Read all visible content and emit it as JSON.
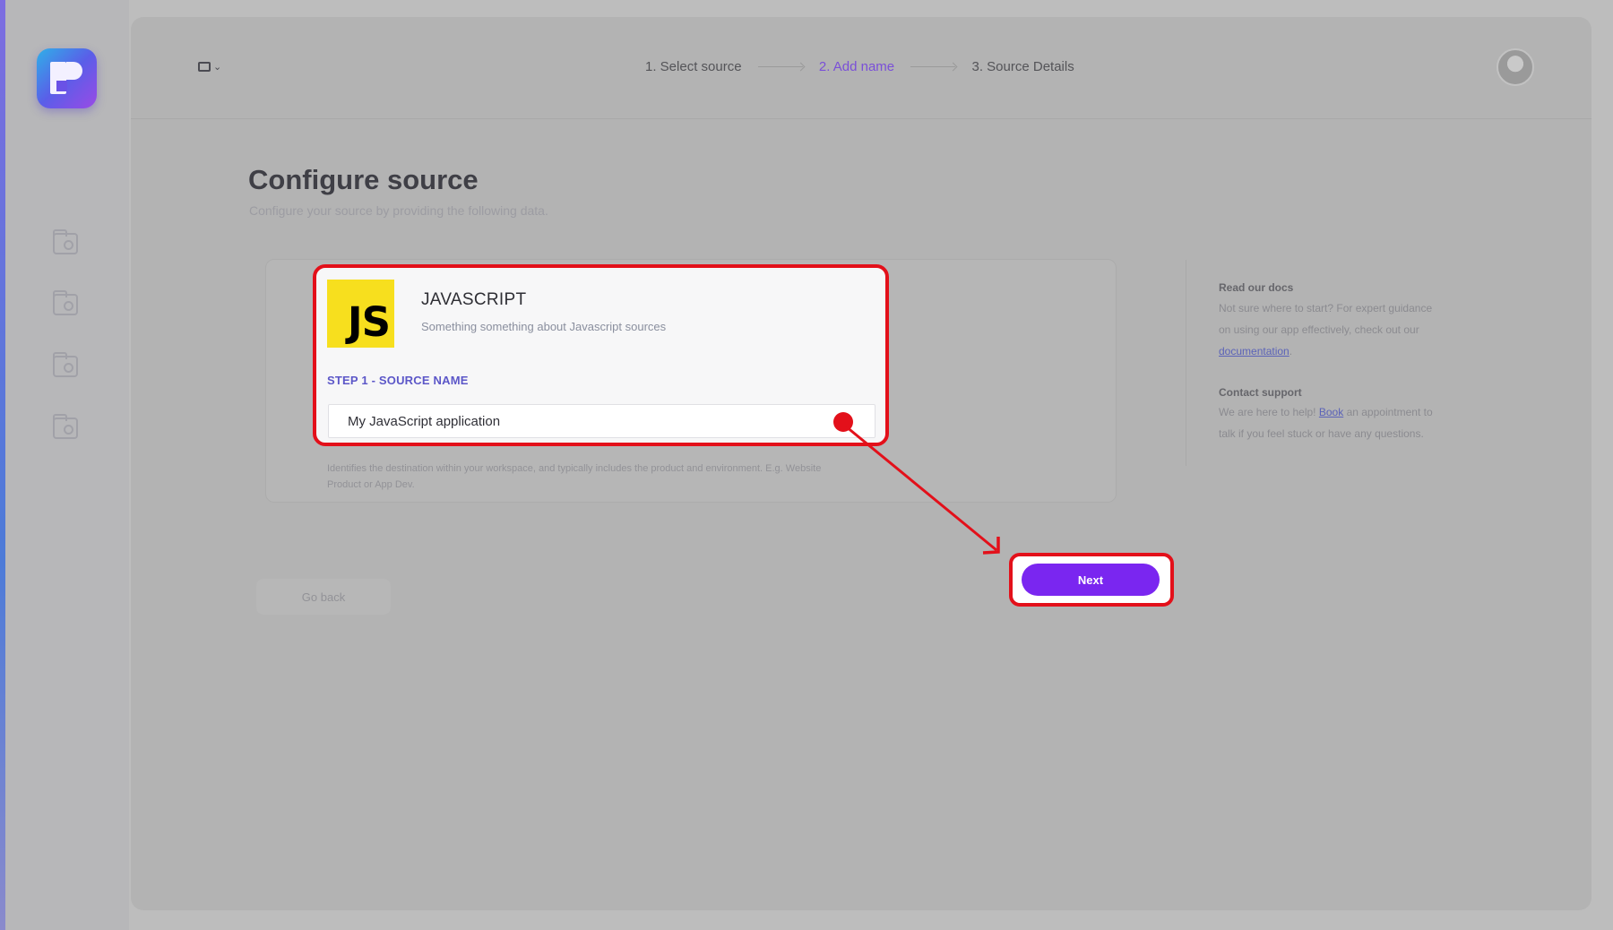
{
  "stepper": {
    "step1": "1. Select source",
    "step2": "2. Add name",
    "step3": "3. Source Details"
  },
  "page": {
    "title": "Configure source",
    "subtitle": "Configure your source by providing the following data."
  },
  "source_card": {
    "logo_text": "JS",
    "name": "JAVASCRIPT",
    "description": "Something something about Javascript sources",
    "step_label": "STEP 1 - SOURCE NAME",
    "input_value": "My JavaScript application",
    "helper_text": "Identifies the destination within your workspace, and typically includes the product and environment. E.g. Website Product or App Dev."
  },
  "actions": {
    "back_label": "Go back",
    "next_label": "Next"
  },
  "help": {
    "docs_title": "Read our docs",
    "docs_text": "Not sure where to start? For expert guidance on using our app effectively, check out our",
    "docs_link": "documentation",
    "docs_end": ".",
    "support_title": "Contact support",
    "support_text_1": "We are here to help!",
    "support_link": "Book",
    "support_text_2": "an appointment to talk if you feel stuck or have any questions."
  },
  "colors": {
    "accent": "#7a26f0",
    "highlight": "#e3101a",
    "js_yellow": "#f7df1e"
  }
}
